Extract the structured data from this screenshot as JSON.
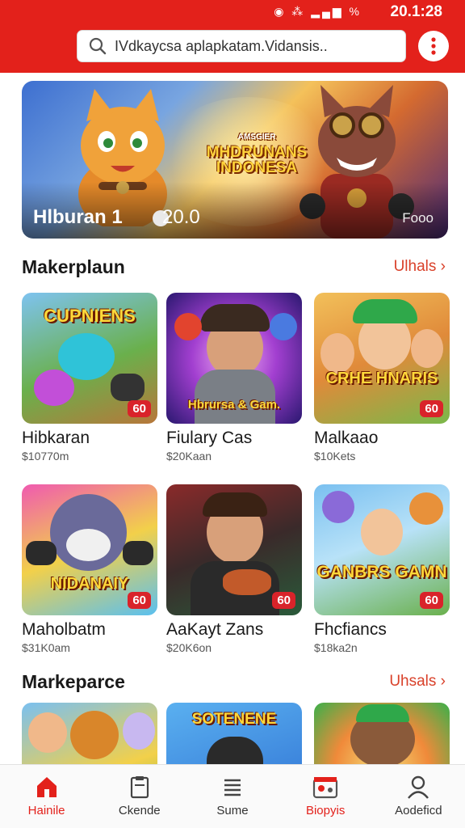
{
  "status": {
    "icons": "◉ ⁂ ▂▄▆ %",
    "time": "20.1:28"
  },
  "search": {
    "placeholder": "IVdkaycsa aplapkatam.Vidansis.."
  },
  "banner": {
    "logo_small": "AMSGIER",
    "logo_line1": "MHDRUNANS",
    "logo_line2": "INDONESA",
    "title": "Hlburan 1",
    "value": "20.0",
    "tag": "Fooo"
  },
  "sections": [
    {
      "title": "Makerplaun",
      "see_all": "Ulhals",
      "cards": [
        {
          "name": "Hibkaran",
          "price": "$10770m",
          "badge": "60",
          "art_text": "CUPNIENS"
        },
        {
          "name": "Fiulary Cas",
          "price": "$20Kaan",
          "badge": "",
          "art_text": "Hbrursa & Gam."
        },
        {
          "name": "Malkaao",
          "price": "$10Kets",
          "badge": "60",
          "art_text": "CRHE HNARIS"
        }
      ]
    },
    {
      "title": "",
      "see_all": "",
      "cards": [
        {
          "name": "Maholbatm",
          "price": "$31K0am",
          "badge": "60",
          "art_text": "NIDANAIY"
        },
        {
          "name": "AaKayt Zans",
          "price": "$20K6on",
          "badge": "60",
          "art_text": ""
        },
        {
          "name": "Fhcfiancs",
          "price": "$18ka2n",
          "badge": "60",
          "art_text": "GANBRS GAMN"
        }
      ]
    },
    {
      "title": "Markeparce",
      "see_all": "Uhsals",
      "cards": [
        {
          "art_text": ""
        },
        {
          "art_text": "SOTENENE"
        },
        {
          "art_text": ""
        }
      ]
    }
  ],
  "nav": [
    {
      "label": "Hainile",
      "icon": "home-icon"
    },
    {
      "label": "Ckende",
      "icon": "clipboard-icon"
    },
    {
      "label": "Sume",
      "icon": "menu-lines-icon"
    },
    {
      "label": "Biopyis",
      "icon": "store-icon"
    },
    {
      "label": "Aodeficd",
      "icon": "user-icon"
    }
  ],
  "colors": {
    "brand": "#e3211b",
    "accent": "#d9412a",
    "badge": "#d9232a"
  }
}
